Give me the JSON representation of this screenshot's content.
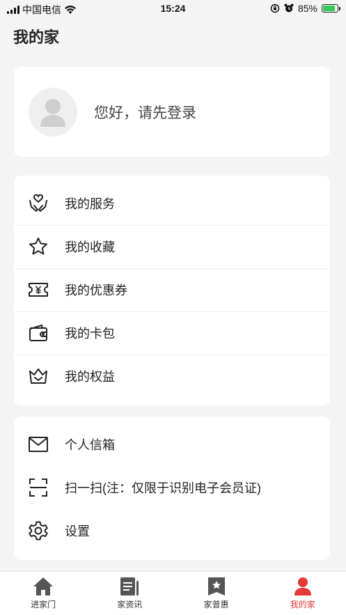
{
  "status_bar": {
    "carrier": "中国电信",
    "time": "15:24",
    "battery_percent": "85%",
    "battery_level": 0.85
  },
  "page": {
    "title": "我的家"
  },
  "login": {
    "prompt": "您好，请先登录"
  },
  "menu_primary": [
    {
      "label": "我的服务",
      "icon": "service-hands-icon"
    },
    {
      "label": "我的收藏",
      "icon": "star-icon"
    },
    {
      "label": "我的优惠券",
      "icon": "coupon-icon"
    },
    {
      "label": "我的卡包",
      "icon": "wallet-icon"
    },
    {
      "label": "我的权益",
      "icon": "crown-icon"
    }
  ],
  "menu_secondary": [
    {
      "label": "个人信箱",
      "icon": "mail-icon"
    },
    {
      "label": "扫一扫(注：仅限于识别电子会员证)",
      "icon": "scan-icon"
    },
    {
      "label": "设置",
      "icon": "gear-icon"
    }
  ],
  "tab_bar": [
    {
      "label": "进家门",
      "icon": "home-icon",
      "active": false
    },
    {
      "label": "家资讯",
      "icon": "news-icon",
      "active": false
    },
    {
      "label": "家普惠",
      "icon": "bookmark-star-icon",
      "active": false
    },
    {
      "label": "我的家",
      "icon": "person-icon",
      "active": true
    }
  ],
  "colors": {
    "accent": "#e53935",
    "background": "#f4f4f4",
    "card": "#ffffff",
    "tab_inactive_icon": "#555555"
  }
}
